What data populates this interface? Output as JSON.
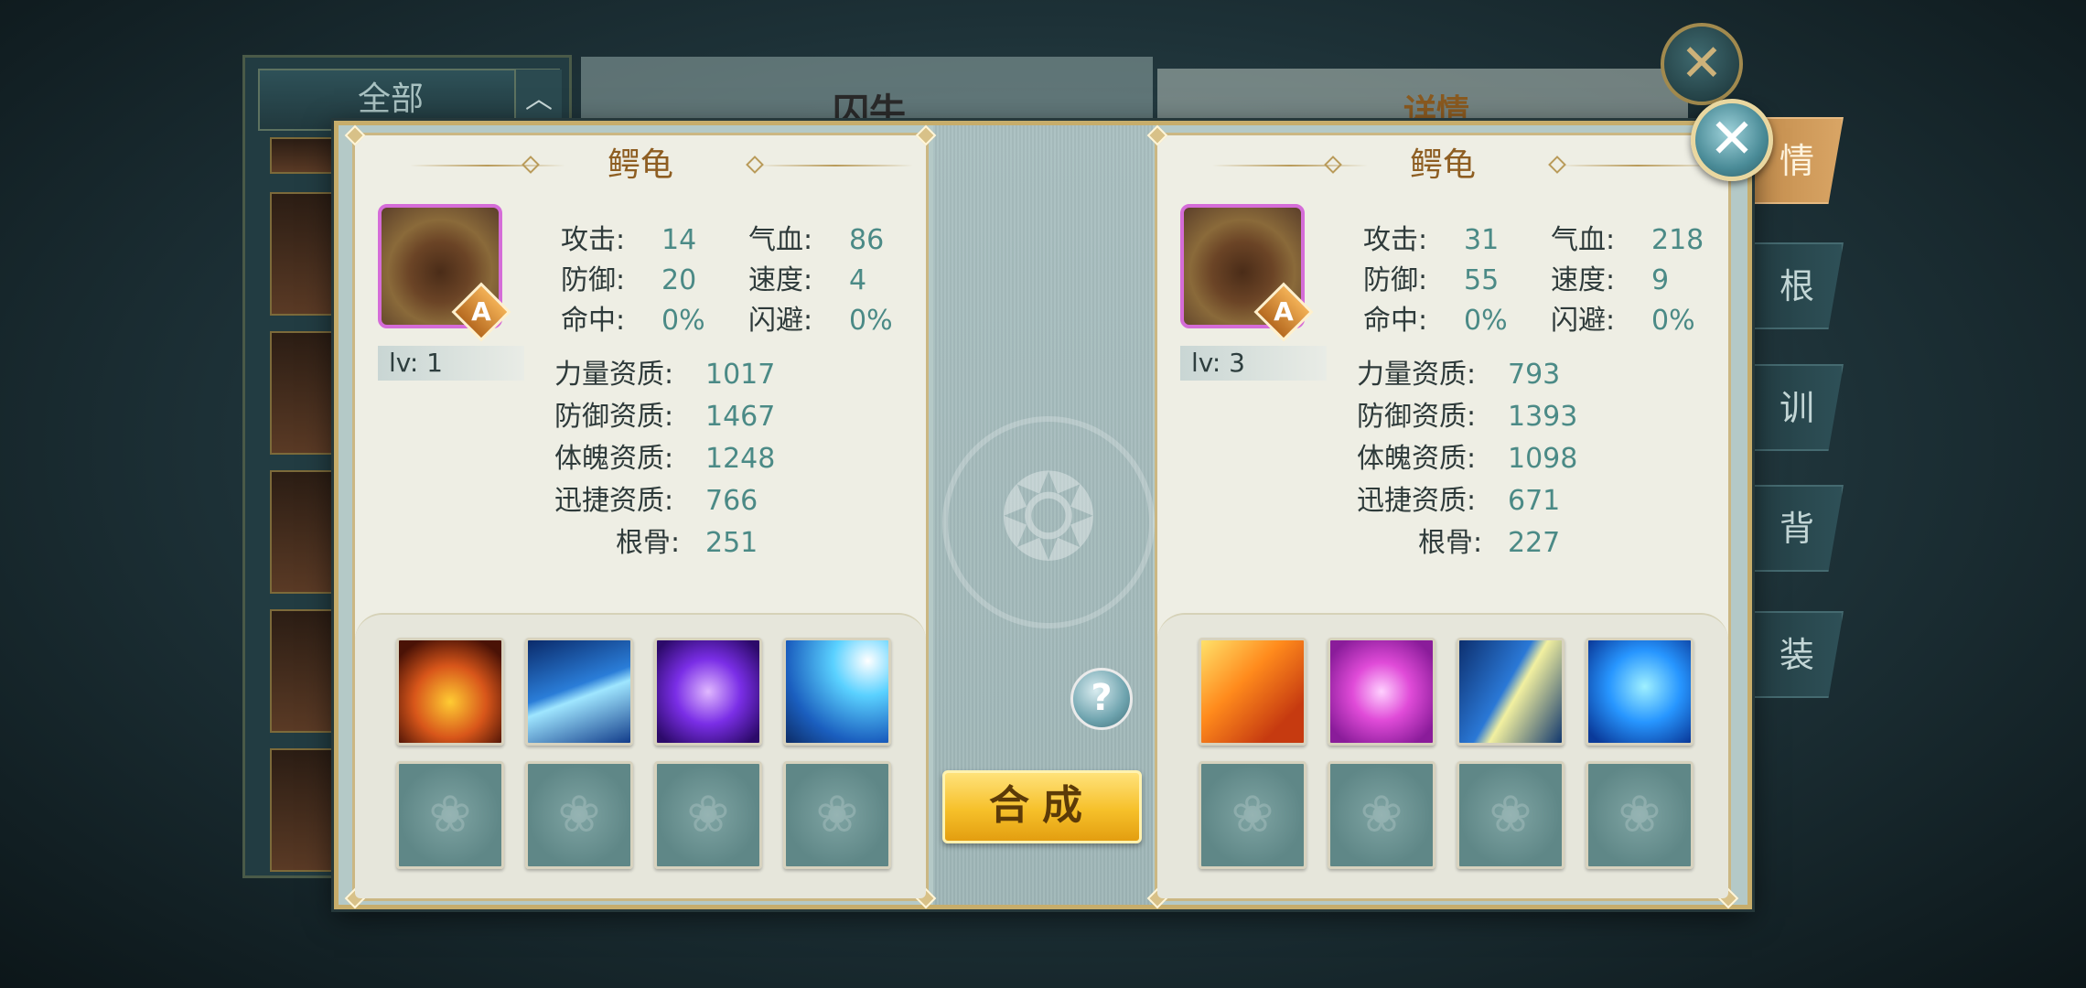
{
  "background": {
    "filter_label": "全部",
    "filter_toggle": "︿",
    "center_title": "囚牛",
    "right_title": "详情",
    "side_tabs": [
      "情",
      "根 养",
      "训 养",
      "背 包",
      "装 备"
    ]
  },
  "left_pet": {
    "name": "鳄龟",
    "rank": "A",
    "level": "lv: 1",
    "stats": {
      "attack_label": "攻击:",
      "attack": "14",
      "hp_label": "气血:",
      "hp": "86",
      "defense_label": "防御:",
      "defense": "20",
      "speed_label": "速度:",
      "speed": "4",
      "hit_label": "命中:",
      "hit": "0%",
      "dodge_label": "闪避:",
      "dodge": "0%"
    },
    "aptitudes": {
      "strength_label": "力量资质:",
      "strength": "1017",
      "defense_label": "防御资质:",
      "defense": "1467",
      "physique_label": "体魄资质:",
      "physique": "1248",
      "agility_label": "迅捷资质:",
      "agility": "766",
      "bone_label": "根骨:",
      "bone": "251"
    },
    "skills": [
      "fire-beast-skill-icon",
      "ice-spikes-skill-icon",
      "purple-vortex-skill-icon",
      "lightning-skill-icon"
    ]
  },
  "right_pet": {
    "name": "鳄龟",
    "rank": "A",
    "level": "lv: 3",
    "stats": {
      "attack_label": "攻击:",
      "attack": "31",
      "hp_label": "气血:",
      "hp": "218",
      "defense_label": "防御:",
      "defense": "55",
      "speed_label": "速度:",
      "speed": "9",
      "hit_label": "命中:",
      "hit": "0%",
      "dodge_label": "闪避:",
      "dodge": "0%"
    },
    "aptitudes": {
      "strength_label": "力量资质:",
      "strength": "793",
      "defense_label": "防御资质:",
      "defense": "1393",
      "physique_label": "体魄资质:",
      "physique": "1098",
      "agility_label": "迅捷资质:",
      "agility": "671",
      "bone_label": "根骨:",
      "bone": "227"
    },
    "skills": [
      "flame-claw-skill-icon",
      "shield-skill-icon",
      "crescent-slash-skill-icon",
      "blue-beast-skill-icon"
    ]
  },
  "buttons": {
    "help": "?",
    "merge": "合成",
    "close": "✕"
  },
  "colors": {
    "accent_gold": "#c7ad6b",
    "title_brown": "#8e5e22",
    "value_teal": "#4b8a86",
    "merge_button": "#f6c02a"
  }
}
